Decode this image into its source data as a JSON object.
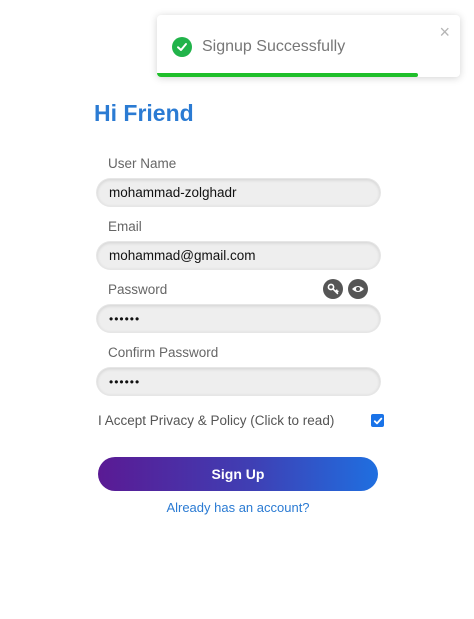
{
  "toast": {
    "message": "Signup Successfully",
    "close_symbol": "×",
    "progress": 0.86,
    "icons": {
      "status": "check-circle-icon",
      "close": "close-icon"
    },
    "colors": {
      "success": "#21b34a",
      "progress": "#1fbf2a"
    }
  },
  "form": {
    "title": "Hi Friend",
    "username": {
      "label": "User Name",
      "value": "mohammad-zolghadr"
    },
    "email": {
      "label": "Email",
      "value": "mohammad@gmail.com"
    },
    "password": {
      "label": "Password",
      "value": "••••••",
      "icons": [
        "key-icon",
        "eye-icon"
      ]
    },
    "confirm_password": {
      "label": "Confirm Password",
      "value": "••••••"
    },
    "policy": {
      "label": "I Accept Privacy & Policy (Click to read)",
      "checked": true
    },
    "submit_label": "Sign Up",
    "login_link": "Already has an account?"
  },
  "colors": {
    "accent": "#2b7bd3",
    "button_gradient": [
      "#5a1a94",
      "#1f6fe0"
    ],
    "checkbox": "#1a73e8"
  }
}
